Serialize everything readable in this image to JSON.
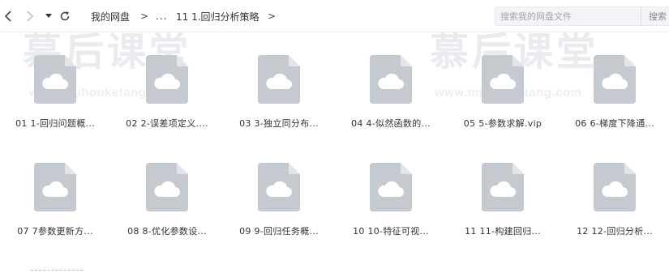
{
  "breadcrumb": {
    "root": "我的网盘",
    "separator": ">",
    "ellipsis": "...",
    "current": "11 1.回归分析策略"
  },
  "search": {
    "placeholder": "搜索我的网盘文件",
    "button_label": "搜索"
  },
  "watermark": {
    "cn_text": "慕后课堂",
    "en_text": "www.muhouketang.com"
  },
  "files": [
    {
      "name": "01 1-回归问题概...",
      "icon": "cloud-file-icon"
    },
    {
      "name": "02 2-误差项定义....",
      "icon": "cloud-file-icon"
    },
    {
      "name": "03 3-独立同分布...",
      "icon": "cloud-file-icon"
    },
    {
      "name": "04 4-似然函数的...",
      "icon": "cloud-file-icon"
    },
    {
      "name": "05 5-参数求解.vip",
      "icon": "cloud-file-icon"
    },
    {
      "name": "06 6-梯度下降通...",
      "icon": "cloud-file-icon"
    },
    {
      "name": "07 7参数更新方...",
      "icon": "cloud-file-icon"
    },
    {
      "name": "08 8-优化参数设...",
      "icon": "cloud-file-icon"
    },
    {
      "name": "09 9-回归任务概...",
      "icon": "cloud-file-icon"
    },
    {
      "name": "10 10-特征可视...",
      "icon": "cloud-file-icon"
    },
    {
      "name": "11 11-构建回归...",
      "icon": "cloud-file-icon"
    },
    {
      "name": "12 12-回归分析...",
      "icon": "cloud-file-icon"
    }
  ],
  "colors": {
    "icon_body": "#c5c9d0",
    "icon_fold": "#e3e5e9",
    "cloud": "#ffffff"
  }
}
